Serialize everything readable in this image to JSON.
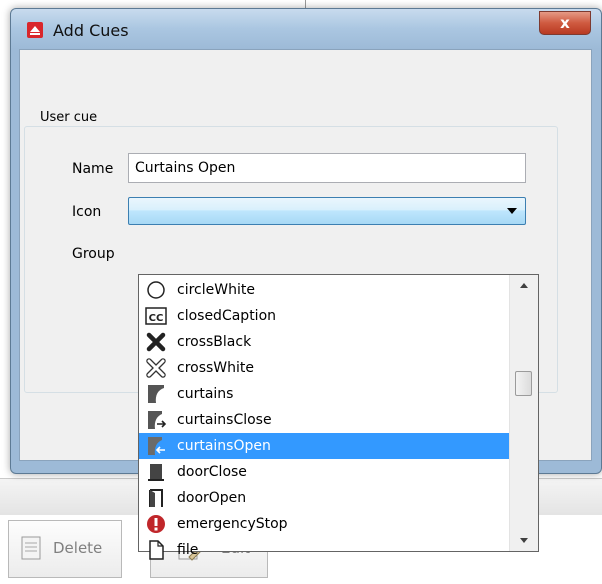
{
  "window": {
    "title": "Add Cues",
    "close_glyph": "x"
  },
  "groupbox": {
    "legend": "User cue"
  },
  "form": {
    "name_label": "Name",
    "name_value": "Curtains Open",
    "icon_label": "Icon",
    "icon_value": "",
    "group_label": "Group"
  },
  "dropdown": {
    "items": [
      {
        "label": "circleWhite",
        "icon": "circle-white-icon"
      },
      {
        "label": "closedCaption",
        "icon": "closed-caption-icon"
      },
      {
        "label": "crossBlack",
        "icon": "cross-black-icon"
      },
      {
        "label": "crossWhite",
        "icon": "cross-white-icon"
      },
      {
        "label": "curtains",
        "icon": "curtains-icon"
      },
      {
        "label": "curtainsClose",
        "icon": "curtains-close-icon"
      },
      {
        "label": "curtainsOpen",
        "icon": "curtains-open-icon",
        "selected": true
      },
      {
        "label": "doorClose",
        "icon": "door-close-icon"
      },
      {
        "label": "doorOpen",
        "icon": "door-open-icon"
      },
      {
        "label": "emergencyStop",
        "icon": "emergency-stop-icon"
      },
      {
        "label": "file",
        "icon": "file-icon"
      }
    ],
    "cc_text": "CC"
  },
  "background": {
    "delete_label": "Delete",
    "edit_label": "Edit"
  },
  "colors": {
    "selection": "#3399ff",
    "close_button": "#cf5a40",
    "emergency": "#c0262a"
  }
}
